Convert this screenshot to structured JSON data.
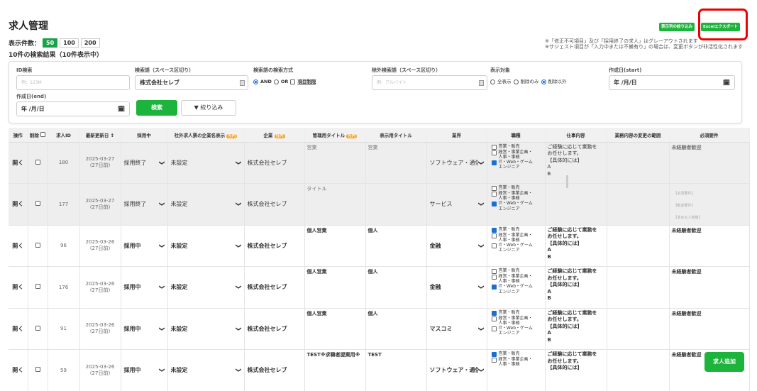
{
  "page_title": "求人管理",
  "per_page": {
    "label": "表示件数：",
    "options": [
      "50",
      "100",
      "200"
    ],
    "active": "50"
  },
  "result_text": "10件の検索結果（10件表示中）",
  "top_buttons": {
    "narrow": "表示列の絞り込み",
    "export": "Excelエクスポート"
  },
  "notes": [
    "※「修正不可項目」及び「採用終了の求人」はグレーアウトされます",
    "※サジェスト項目が「入力中または不備有り」の場合は、変更ボタンが非活性化されます"
  ],
  "filters": {
    "id_label": "ID検索",
    "id_placeholder": "例：123M",
    "keyword_label": "検索語（スペース区切り）",
    "keyword_value": "株式会社セレブ",
    "method_label": "検索語の検索方式",
    "method_and": "AND",
    "method_or": "OR",
    "method_item": "項目制限",
    "exclude_label": "除外検索語（スペース区切り）",
    "exclude_placeholder": "例：アルバイト",
    "target_label": "表示対象",
    "target_all": "全表示",
    "target_deleted": "削除のみ",
    "target_not_deleted": "削除以外",
    "created_start_label": "作成日(start)",
    "created_start_value": "年 /月/日",
    "created_end_label": "作成日(end)",
    "created_end_value": "年 /月/日",
    "search_button": "検索",
    "filter_button": "絞り込み"
  },
  "table": {
    "headers": [
      "操作",
      "削除",
      "求人ID",
      "最新更新日",
      "採用中",
      "社外求人票の企業名表示",
      "企業",
      "管理用タイトル",
      "表示用タイトル",
      "業界",
      "職種",
      "仕事内容",
      "業務内容の変更の範囲",
      "必須要件"
    ],
    "badge": "社内",
    "open_label": "開く",
    "rows": [
      {
        "id": "180",
        "date": "2025-03-27",
        "ago": "(27日前)",
        "status": "採用終了",
        "display": "未設定",
        "company": "株式会社セレブ",
        "admin_title": "営業",
        "disp_title": "営業",
        "industry": "ソフトウェア・通信",
        "jobs": [
          [
            "営業・販売",
            false
          ],
          [
            "経営・事業企画・人事・事務",
            false
          ],
          [
            "IT・Web・ゲームエンジニア",
            true
          ]
        ],
        "work": [
          "ご経験に応じて業務を",
          "お任せします。",
          "【具体的には】",
          "A",
          "B"
        ],
        "req": "未経験者歓迎",
        "gray": true
      },
      {
        "id": "177",
        "date": "2025-03-27",
        "ago": "(27日前)",
        "status": "採用終了",
        "display": "未設定",
        "company": "株式会社セレブ",
        "admin_title": "タイトル",
        "disp_title": "",
        "industry": "サービス",
        "jobs": [
          [
            "営業・販売",
            false
          ],
          [
            "経営・事業企画・人事・事務",
            false
          ],
          [
            "IT・Web・ゲームエンジニア",
            true
          ]
        ],
        "work": [],
        "req": "",
        "gray": true
      },
      {
        "id": "96",
        "date": "2025-03-26",
        "ago": "(27日前)",
        "status": "採用中",
        "display": "未設定",
        "company": "株式会社セレブ",
        "admin_title": "個人営業",
        "disp_title": "個人",
        "industry": "金融",
        "jobs": [
          [
            "営業・販売",
            true
          ],
          [
            "経営・事業企画・人事・事務",
            false
          ],
          [
            "IT・Web・ゲームエンジニア",
            false
          ]
        ],
        "work": [
          "ご経験に応じて業務を",
          "お任せします。",
          "【具体的には】",
          "A",
          "B"
        ],
        "req": "未経験者歓迎",
        "gray": false
      },
      {
        "id": "176",
        "date": "2025-03-26",
        "ago": "(27日前)",
        "status": "採用中",
        "display": "未設定",
        "company": "株式会社セレブ",
        "admin_title": "個人営業",
        "disp_title": "個人",
        "industry": "金融",
        "jobs": [
          [
            "営業・販売",
            false
          ],
          [
            "経営・事業企画・人事・事務",
            false
          ],
          [
            "IT・Web・ゲームエンジニア",
            true
          ]
        ],
        "work": [
          "ご経験に応じて業務を",
          "お任せします。",
          "【具体的には】",
          "A",
          "B"
        ],
        "req": "未経験者歓迎",
        "gray": false
      },
      {
        "id": "91",
        "date": "2025-03-26",
        "ago": "(27日前)",
        "status": "採用中",
        "display": "未設定",
        "company": "株式会社セレブ",
        "admin_title": "個人営業",
        "disp_title": "個人",
        "industry": "マスコミ",
        "jobs": [
          [
            "営業・販売",
            true
          ],
          [
            "経営・事業企画・人事・事務",
            false
          ],
          [
            "IT・Web・ゲームエンジニア",
            false
          ]
        ],
        "work": [
          "ご経験に応じて業務を",
          "お任せします。",
          "【具体的には】",
          "A",
          "B"
        ],
        "req": "未経験者歓迎",
        "gray": false
      },
      {
        "id": "59",
        "date": "2025-03-26",
        "ago": "(27日前)",
        "status": "採用中",
        "display": "未設定",
        "company": "株式会社セレブ",
        "admin_title": "TEST※求職者提案用※",
        "disp_title": "TEST",
        "industry": "ソフトウェア・通信",
        "jobs": [
          [
            "営業・販売",
            true
          ],
          [
            "経営・事業企画・人事・事務",
            false
          ]
        ],
        "work": [
          "ご経験に応じて業務を",
          "お任せします。",
          "【具体的には】"
        ],
        "req": "未経験者歓迎",
        "gray": false
      }
    ]
  },
  "faded_req": [
    "【必須要件】",
    "【歓迎要件】",
    "【求める人物像】"
  ],
  "add_button": "求人追加"
}
